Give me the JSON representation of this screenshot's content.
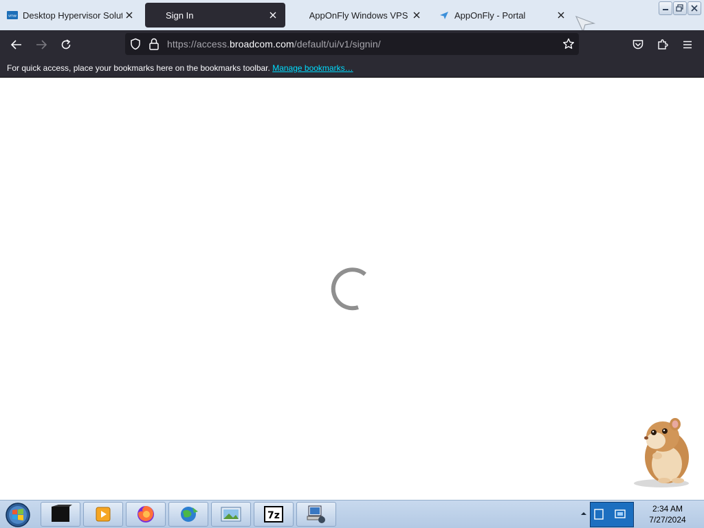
{
  "browser": {
    "tabs": [
      {
        "title": "Desktop Hypervisor Solution",
        "active": false,
        "icon": "vmware-favicon-icon"
      },
      {
        "title": "Sign In",
        "active": true,
        "icon": "none"
      },
      {
        "title": "AppOnFly Windows VPS & C",
        "active": false,
        "icon": "none"
      },
      {
        "title": "AppOnFly - Portal",
        "active": false,
        "icon": "paper-plane-favicon-icon"
      }
    ],
    "url": {
      "prefix": "https://access.",
      "domain": "broadcom.com",
      "path": "/default/ui/v1/signin/"
    },
    "bookmarks_bar": {
      "message": "For quick access, place your bookmarks here on the bookmarks toolbar.",
      "link": "Manage bookmarks…"
    }
  },
  "content": {
    "state": "loading",
    "spinner_color": "#8f8f8f"
  },
  "taskbar": {
    "items": [
      "terminal-icon",
      "media-player-icon",
      "firefox-icon",
      "globe-download-icon",
      "image-viewer-icon",
      "7zip-icon",
      "network-computer-icon"
    ],
    "clock": {
      "time": "2:34 AM",
      "date": "7/27/2024"
    }
  },
  "colors": {
    "tabstrip": "#dfe8f3",
    "toolbar": "#2b2a33",
    "urlbar": "#1c1b22",
    "link": "#00ddff"
  }
}
